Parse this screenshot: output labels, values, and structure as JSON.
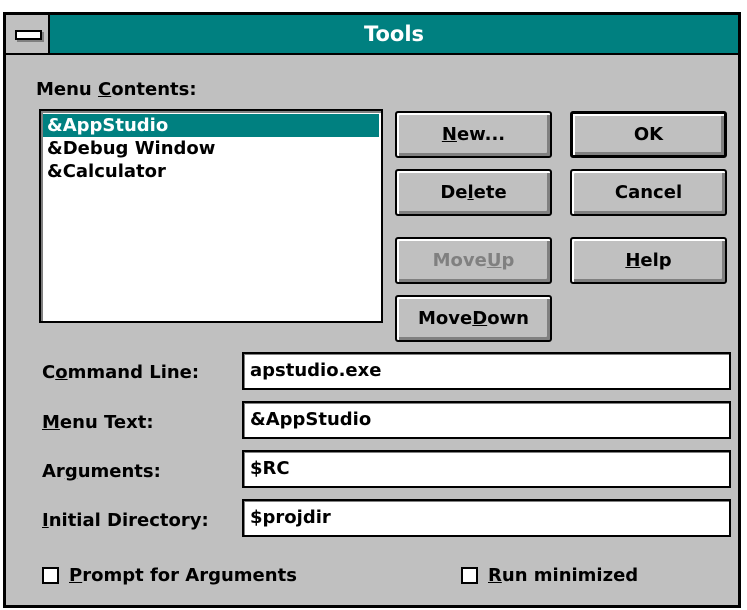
{
  "window": {
    "title": "Tools"
  },
  "menu_contents": {
    "label_pre": "Menu ",
    "label_accel": "C",
    "label_post": "ontents:",
    "items": [
      "&AppStudio",
      "&Debug Window",
      "&Calculator"
    ],
    "selected_index": 0
  },
  "buttons": {
    "new": {
      "pre": "",
      "accel": "N",
      "post": "ew..."
    },
    "delete": {
      "pre": "De",
      "accel": "l",
      "post": "ete"
    },
    "move_up": {
      "pre": "Move ",
      "accel": "U",
      "post": "p"
    },
    "move_down": {
      "pre": "Move ",
      "accel": "D",
      "post": "own"
    },
    "ok": {
      "label": "OK"
    },
    "cancel": {
      "label": "Cancel"
    },
    "help": {
      "pre": "",
      "accel": "H",
      "post": "elp"
    }
  },
  "fields": {
    "command_line": {
      "pre": "C",
      "accel": "o",
      "post": "mmand Line:",
      "value": "apstudio.exe"
    },
    "menu_text": {
      "pre": "",
      "accel": "M",
      "post": "enu Text:",
      "value": "&AppStudio"
    },
    "arguments": {
      "pre": "Ar",
      "accel": "g",
      "post": "uments:",
      "value": "$RC"
    },
    "initial_directory": {
      "pre": "",
      "accel": "I",
      "post": "nitial Directory:",
      "value": "$projdir"
    }
  },
  "checkboxes": {
    "prompt_args": {
      "pre": "",
      "accel": "P",
      "post": "rompt for Arguments",
      "checked": false
    },
    "run_min": {
      "pre": "",
      "accel": "R",
      "post": "un minimized",
      "checked": false
    }
  },
  "colors": {
    "title_bar": "#008080",
    "face": "#c0c0c0",
    "selection": "#008080"
  }
}
